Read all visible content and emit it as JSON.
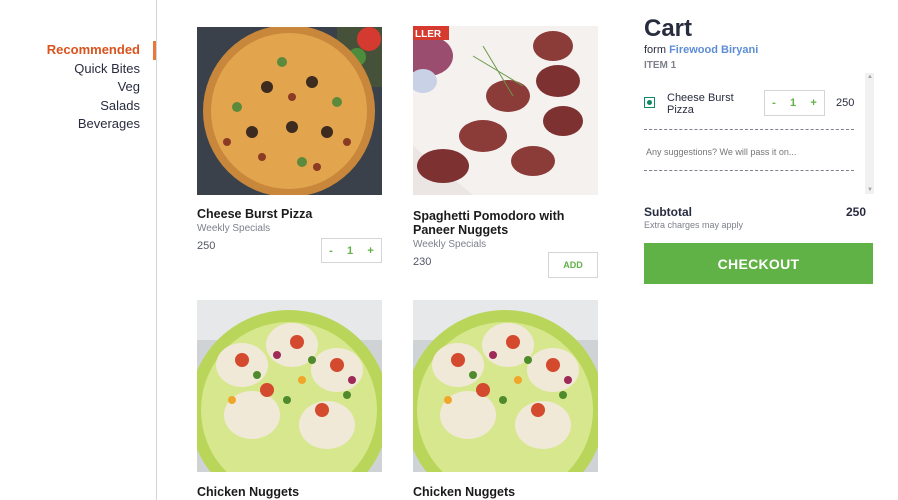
{
  "sidebar": {
    "categories": [
      {
        "label": "Recommended",
        "active": true
      },
      {
        "label": "Quick Bites",
        "active": false
      },
      {
        "label": "Veg",
        "active": false
      },
      {
        "label": "Salads",
        "active": false
      },
      {
        "label": "Beverages",
        "active": false
      }
    ]
  },
  "products": [
    {
      "name": "Cheese Burst Pizza",
      "category": "Weekly Specials",
      "price": "250",
      "qty": "1",
      "image": "pizza"
    },
    {
      "name": "Spaghetti Pomodoro with Paneer Nuggets",
      "category": "Weekly Specials",
      "price": "230",
      "add_label": "ADD",
      "badge": "LLER",
      "image": "nuggets-grill"
    },
    {
      "name": "Chicken Nuggets",
      "image": "chaat-plate"
    },
    {
      "name": "Chicken Nuggets",
      "image": "chaat-plate"
    }
  ],
  "qty_controls": {
    "minus": "-",
    "plus": "+"
  },
  "cart": {
    "title": "Cart",
    "from_prefix": "form",
    "restaurant": "Firewood Biryani",
    "item_count": "ITEM 1",
    "items": [
      {
        "name": "Cheese Burst Pizza",
        "qty": "1",
        "price": "250",
        "veg": true
      }
    ],
    "suggestion_placeholder": "Any suggestions? We will pass it on...",
    "subtotal_label": "Subtotal",
    "subtotal_value": "250",
    "extra_charges": "Extra charges may apply",
    "checkout_label": "CHECKOUT"
  },
  "colors": {
    "accent_orange": "#e46d1e",
    "green": "#60b246",
    "link_blue": "#5d8ed5"
  }
}
